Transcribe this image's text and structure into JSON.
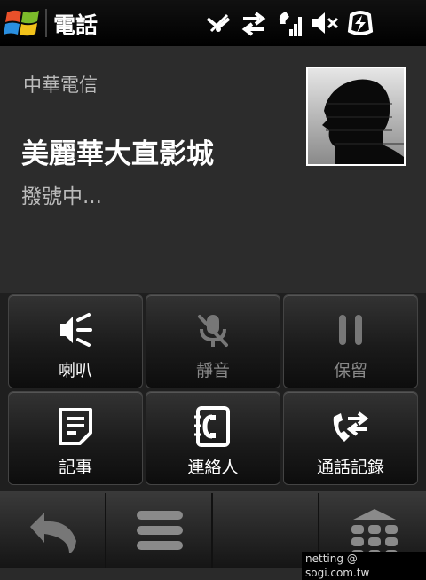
{
  "status_bar": {
    "app_title": "電話",
    "icons": [
      "windows-start-logo",
      "wireless-off-icon",
      "data-transfer-icon",
      "signal-strength-icon",
      "speaker-muted-icon",
      "battery-charging-icon"
    ]
  },
  "call": {
    "carrier": "中華電信",
    "contact_name": "美麗華大直影城",
    "status": "撥號中..."
  },
  "buttons": [
    {
      "label": "喇叭",
      "icon": "speaker-icon",
      "enabled": true
    },
    {
      "label": "靜音",
      "icon": "mute-mic-icon",
      "enabled": false
    },
    {
      "label": "保留",
      "icon": "pause-icon",
      "enabled": false
    },
    {
      "label": "記事",
      "icon": "note-icon",
      "enabled": true
    },
    {
      "label": "連絡人",
      "icon": "contacts-icon",
      "enabled": true
    },
    {
      "label": "通話記錄",
      "icon": "call-log-icon",
      "enabled": true
    }
  ],
  "softkeys": [
    "back-icon",
    "menu-icon",
    "",
    "keypad-icon"
  ],
  "watermark": "netting   @ sogi.com.tw",
  "colors": {
    "background": "#2c2c2c",
    "statusbar": "#000000",
    "disabled": "#888888"
  }
}
